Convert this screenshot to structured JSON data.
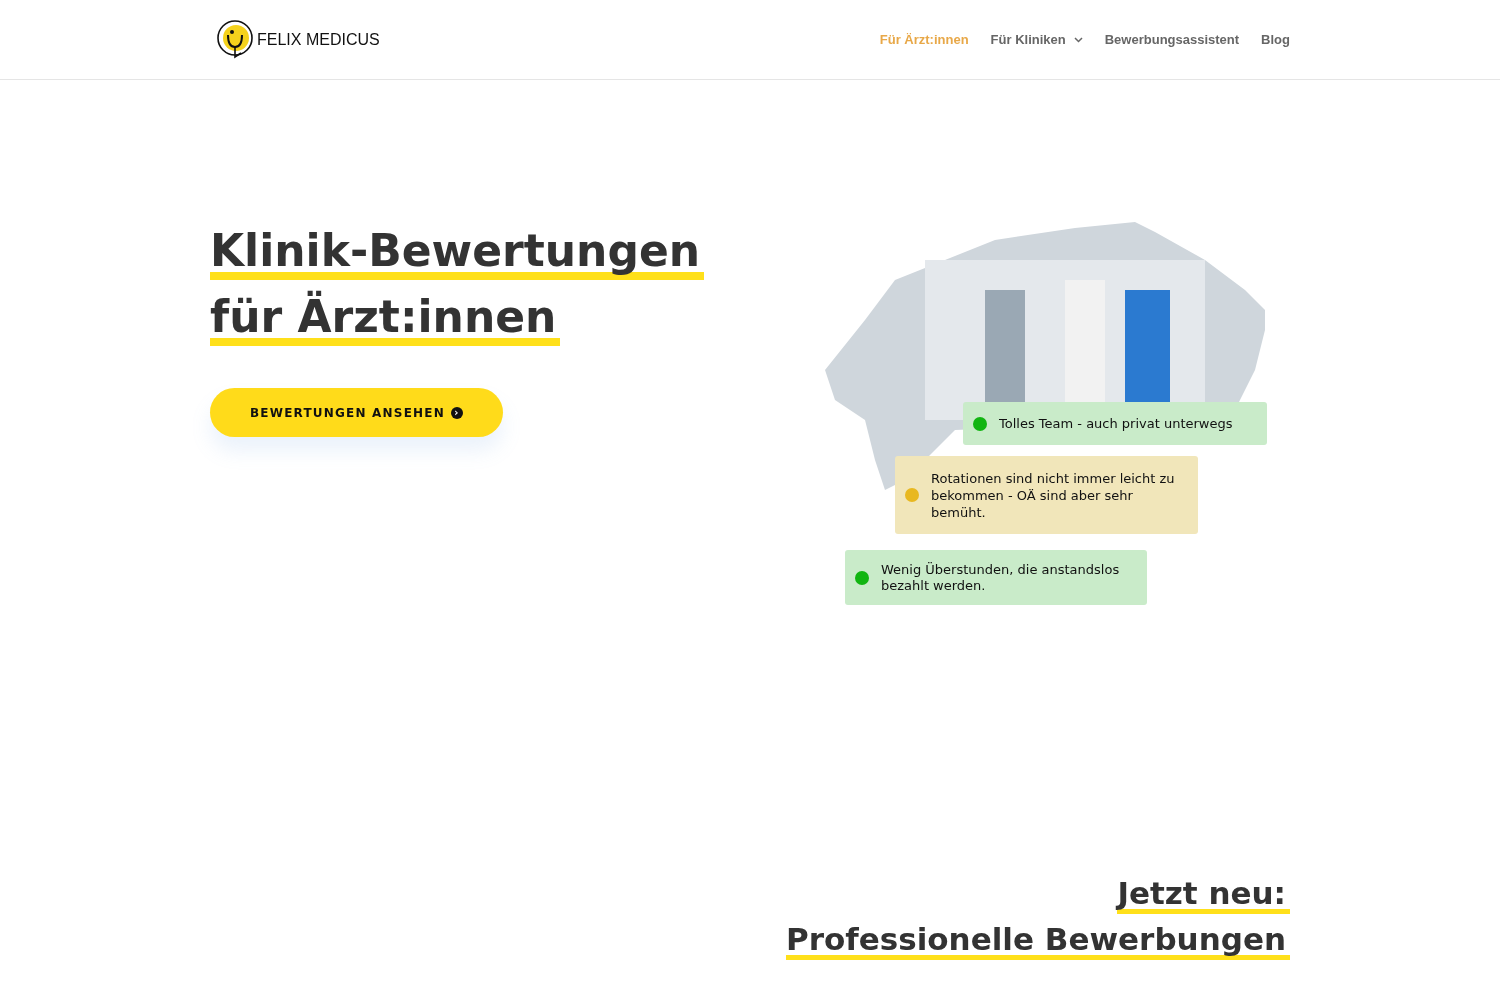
{
  "header": {
    "logo_text": "FELIX MEDICUS",
    "nav": [
      {
        "label": "Für Ärzt:innen",
        "selected": true,
        "dropdown": false
      },
      {
        "label": "Für Kliniken",
        "selected": false,
        "dropdown": true
      },
      {
        "label": "Bewerbungsassistent",
        "selected": false,
        "dropdown": false
      },
      {
        "label": "Blog",
        "selected": false,
        "dropdown": false
      }
    ]
  },
  "hero": {
    "title_lines": [
      "Klinik-Bewertungen",
      "für Ärzt:innen"
    ],
    "button": {
      "label": "BEWERTUNGEN ANSEHEN",
      "icon": "›"
    },
    "reviews": [
      {
        "text": "Tolles Team - auch privat unterwegs",
        "kind": "positive",
        "color": "#11b511"
      },
      {
        "text": "Rotationen sind nicht immer leicht zu bekommen - OÄ sind aber sehr bemüht.",
        "kind": "mixed",
        "color": "#e8b820"
      },
      {
        "text": "Wenig Überstunden, die anstandslos bezahlt werden.",
        "kind": "positive",
        "color": "#11b511"
      }
    ]
  },
  "section": {
    "title_lines": [
      "Jetzt neu:",
      "Professionelle Bewerbungen"
    ]
  }
}
